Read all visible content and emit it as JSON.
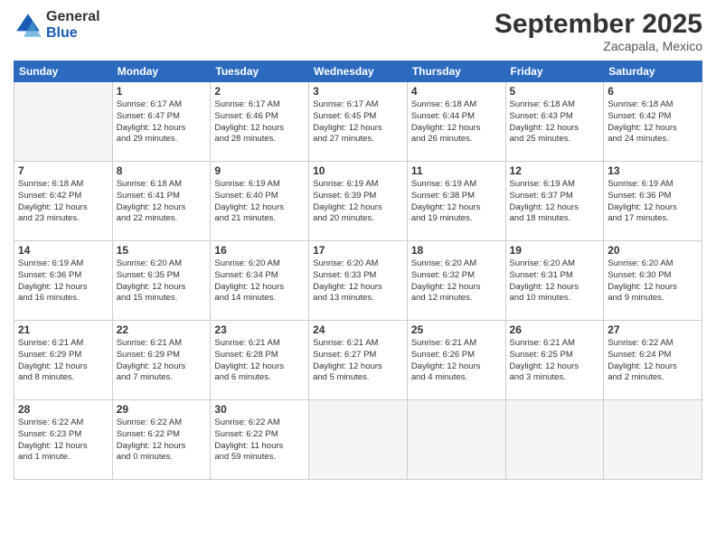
{
  "header": {
    "logo_general": "General",
    "logo_blue": "Blue",
    "title": "September 2025",
    "subtitle": "Zacapala, Mexico"
  },
  "days_of_week": [
    "Sunday",
    "Monday",
    "Tuesday",
    "Wednesday",
    "Thursday",
    "Friday",
    "Saturday"
  ],
  "weeks": [
    [
      {
        "day": "",
        "info": ""
      },
      {
        "day": "1",
        "info": "Sunrise: 6:17 AM\nSunset: 6:47 PM\nDaylight: 12 hours\nand 29 minutes."
      },
      {
        "day": "2",
        "info": "Sunrise: 6:17 AM\nSunset: 6:46 PM\nDaylight: 12 hours\nand 28 minutes."
      },
      {
        "day": "3",
        "info": "Sunrise: 6:17 AM\nSunset: 6:45 PM\nDaylight: 12 hours\nand 27 minutes."
      },
      {
        "day": "4",
        "info": "Sunrise: 6:18 AM\nSunset: 6:44 PM\nDaylight: 12 hours\nand 26 minutes."
      },
      {
        "day": "5",
        "info": "Sunrise: 6:18 AM\nSunset: 6:43 PM\nDaylight: 12 hours\nand 25 minutes."
      },
      {
        "day": "6",
        "info": "Sunrise: 6:18 AM\nSunset: 6:42 PM\nDaylight: 12 hours\nand 24 minutes."
      }
    ],
    [
      {
        "day": "7",
        "info": "Sunrise: 6:18 AM\nSunset: 6:42 PM\nDaylight: 12 hours\nand 23 minutes."
      },
      {
        "day": "8",
        "info": "Sunrise: 6:18 AM\nSunset: 6:41 PM\nDaylight: 12 hours\nand 22 minutes."
      },
      {
        "day": "9",
        "info": "Sunrise: 6:19 AM\nSunset: 6:40 PM\nDaylight: 12 hours\nand 21 minutes."
      },
      {
        "day": "10",
        "info": "Sunrise: 6:19 AM\nSunset: 6:39 PM\nDaylight: 12 hours\nand 20 minutes."
      },
      {
        "day": "11",
        "info": "Sunrise: 6:19 AM\nSunset: 6:38 PM\nDaylight: 12 hours\nand 19 minutes."
      },
      {
        "day": "12",
        "info": "Sunrise: 6:19 AM\nSunset: 6:37 PM\nDaylight: 12 hours\nand 18 minutes."
      },
      {
        "day": "13",
        "info": "Sunrise: 6:19 AM\nSunset: 6:36 PM\nDaylight: 12 hours\nand 17 minutes."
      }
    ],
    [
      {
        "day": "14",
        "info": "Sunrise: 6:19 AM\nSunset: 6:36 PM\nDaylight: 12 hours\nand 16 minutes."
      },
      {
        "day": "15",
        "info": "Sunrise: 6:20 AM\nSunset: 6:35 PM\nDaylight: 12 hours\nand 15 minutes."
      },
      {
        "day": "16",
        "info": "Sunrise: 6:20 AM\nSunset: 6:34 PM\nDaylight: 12 hours\nand 14 minutes."
      },
      {
        "day": "17",
        "info": "Sunrise: 6:20 AM\nSunset: 6:33 PM\nDaylight: 12 hours\nand 13 minutes."
      },
      {
        "day": "18",
        "info": "Sunrise: 6:20 AM\nSunset: 6:32 PM\nDaylight: 12 hours\nand 12 minutes."
      },
      {
        "day": "19",
        "info": "Sunrise: 6:20 AM\nSunset: 6:31 PM\nDaylight: 12 hours\nand 10 minutes."
      },
      {
        "day": "20",
        "info": "Sunrise: 6:20 AM\nSunset: 6:30 PM\nDaylight: 12 hours\nand 9 minutes."
      }
    ],
    [
      {
        "day": "21",
        "info": "Sunrise: 6:21 AM\nSunset: 6:29 PM\nDaylight: 12 hours\nand 8 minutes."
      },
      {
        "day": "22",
        "info": "Sunrise: 6:21 AM\nSunset: 6:29 PM\nDaylight: 12 hours\nand 7 minutes."
      },
      {
        "day": "23",
        "info": "Sunrise: 6:21 AM\nSunset: 6:28 PM\nDaylight: 12 hours\nand 6 minutes."
      },
      {
        "day": "24",
        "info": "Sunrise: 6:21 AM\nSunset: 6:27 PM\nDaylight: 12 hours\nand 5 minutes."
      },
      {
        "day": "25",
        "info": "Sunrise: 6:21 AM\nSunset: 6:26 PM\nDaylight: 12 hours\nand 4 minutes."
      },
      {
        "day": "26",
        "info": "Sunrise: 6:21 AM\nSunset: 6:25 PM\nDaylight: 12 hours\nand 3 minutes."
      },
      {
        "day": "27",
        "info": "Sunrise: 6:22 AM\nSunset: 6:24 PM\nDaylight: 12 hours\nand 2 minutes."
      }
    ],
    [
      {
        "day": "28",
        "info": "Sunrise: 6:22 AM\nSunset: 6:23 PM\nDaylight: 12 hours\nand 1 minute."
      },
      {
        "day": "29",
        "info": "Sunrise: 6:22 AM\nSunset: 6:22 PM\nDaylight: 12 hours\nand 0 minutes."
      },
      {
        "day": "30",
        "info": "Sunrise: 6:22 AM\nSunset: 6:22 PM\nDaylight: 11 hours\nand 59 minutes."
      },
      {
        "day": "",
        "info": ""
      },
      {
        "day": "",
        "info": ""
      },
      {
        "day": "",
        "info": ""
      },
      {
        "day": "",
        "info": ""
      }
    ]
  ]
}
